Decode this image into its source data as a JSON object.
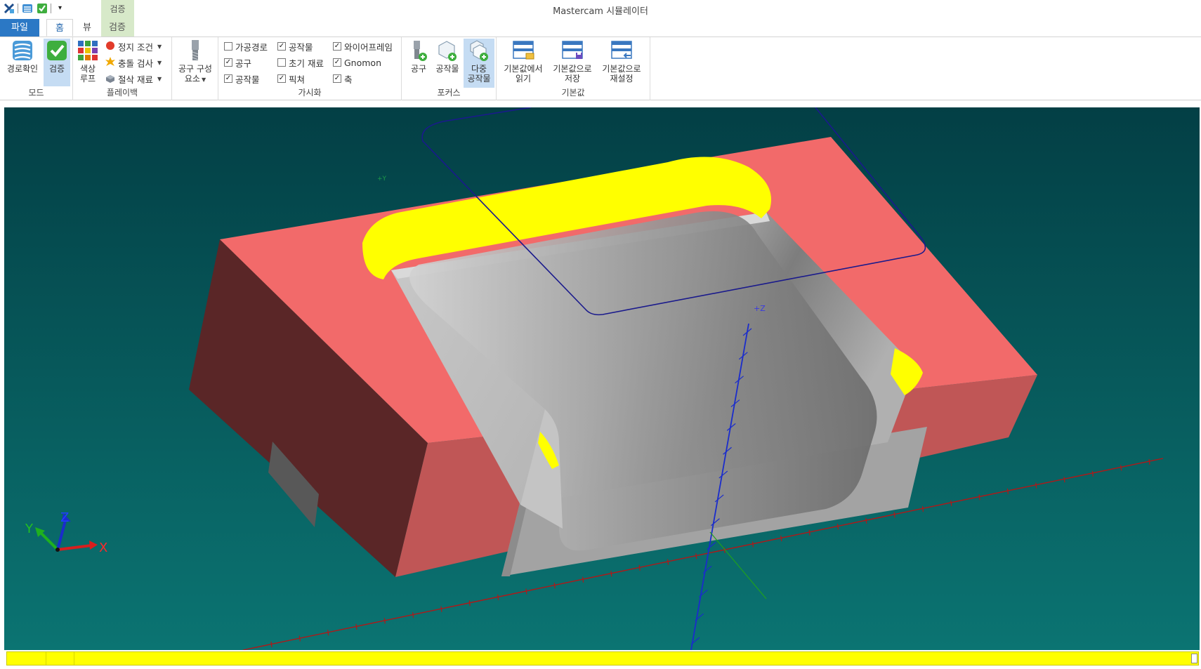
{
  "window": {
    "title": "Mastercam 시뮬레이터"
  },
  "quick_access": {
    "icons": [
      "simulator-app-icon",
      "backplot-small-icon",
      "verify-small-icon",
      "customize-dropdown-icon"
    ],
    "dropdown_glyph": "▾"
  },
  "contextual_group": {
    "label": "검증"
  },
  "tabs": [
    {
      "label": "파일",
      "active": false
    },
    {
      "label": "홈",
      "active": true
    },
    {
      "label": "뷰",
      "active": false
    },
    {
      "label": "검증",
      "active": false
    }
  ],
  "ribbon": {
    "mode": {
      "label": "모드",
      "backplot": "경로확인",
      "verify": "검증"
    },
    "playback": {
      "label": "플레이백",
      "color_loop_line1": "색상",
      "color_loop_line2": "루프",
      "stop_conditions": "정지 조건",
      "collision_check": "충돌 검사",
      "cut_stock": "절삭 재료"
    },
    "tool_components": {
      "line1": "공구 구성",
      "line2": "요소"
    },
    "visibility": {
      "label": "가시화",
      "items": [
        {
          "label": "가공경로",
          "checked": false
        },
        {
          "label": "공구",
          "checked": true
        },
        {
          "label": "공작물",
          "checked": true
        },
        {
          "label": "공작물",
          "checked": true
        },
        {
          "label": "초기 재료",
          "checked": false
        },
        {
          "label": "픽쳐",
          "checked": true
        },
        {
          "label": "와이어프레임",
          "checked": true
        },
        {
          "label": "Gnomon",
          "checked": true
        },
        {
          "label": "축",
          "checked": true
        }
      ]
    },
    "focus": {
      "label": "포커스",
      "tool": "공구",
      "workpiece": "공작물",
      "multi_line1": "다중",
      "multi_line2": "공작물"
    },
    "defaults": {
      "label": "기본값",
      "load_line1": "기본값에서",
      "load_line2": "읽기",
      "save_line1": "기본값으로",
      "save_line2": "저장",
      "reset_line1": "기본값으로",
      "reset_line2": "재설정"
    }
  },
  "viewport": {
    "axis_labels": {
      "x": "X",
      "y": "Y",
      "z": "Z"
    },
    "gnomon_labels": {
      "plus_z": "+Z",
      "plus_y": "+Y"
    },
    "colors": {
      "background_top": "#033f45",
      "background_bottom": "#0b7472",
      "stock_top": "#f26a6a",
      "stock_side_dark": "#5a2627",
      "stock_side_light": "#c05656",
      "machined": "#b8b8b8",
      "highlight": "#ffff00",
      "toolpath": "#1a1a8c"
    }
  },
  "progress": {
    "fraction": 1.0,
    "color": "#ffff00"
  }
}
